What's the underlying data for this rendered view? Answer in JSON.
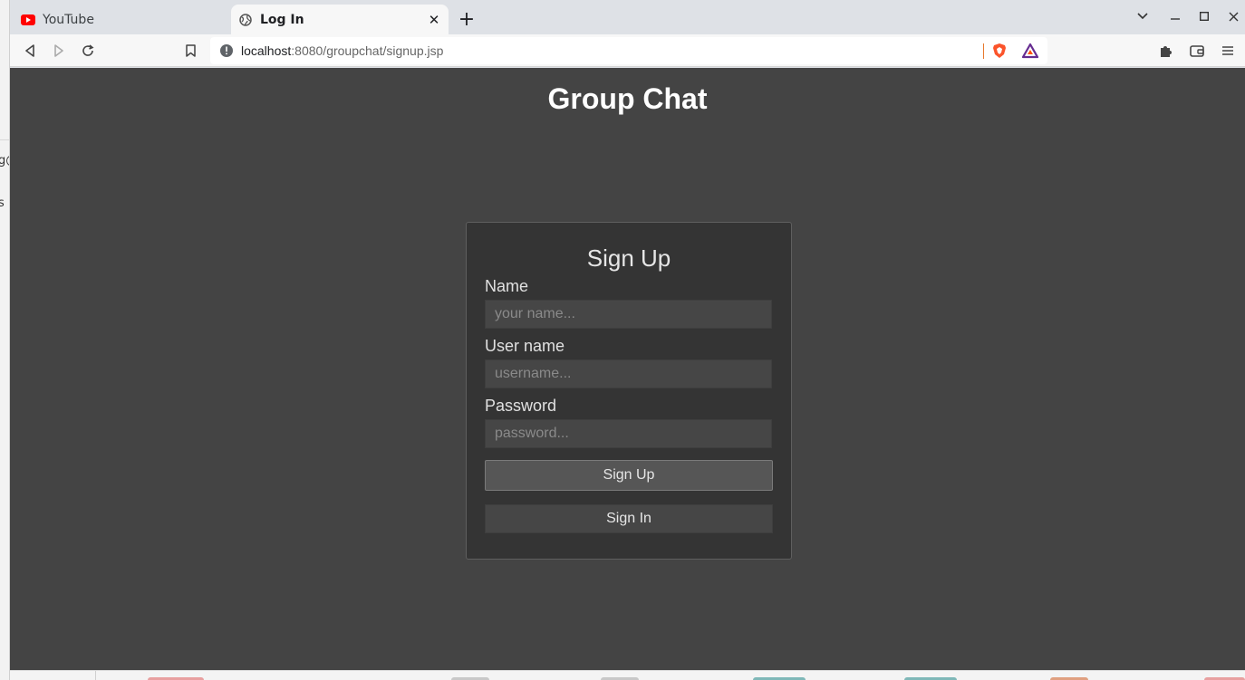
{
  "background": {
    "left_fragments": [
      "g@",
      "s"
    ]
  },
  "browser": {
    "tabs": [
      {
        "title": "YouTube",
        "icon": "youtube-icon",
        "active": false
      },
      {
        "title": "Log In",
        "icon": "globe-icon",
        "active": true
      }
    ],
    "address_bar": {
      "host": "localhost",
      "path": ":8080/groupchat/signup.jsp"
    }
  },
  "page": {
    "app_title": "Group Chat",
    "form": {
      "title": "Sign Up",
      "name_label": "Name",
      "name_placeholder": "your name...",
      "username_label": "User name",
      "username_placeholder": "username...",
      "password_label": "Password",
      "password_placeholder": "password...",
      "signup_button": "Sign Up",
      "signin_button": "Sign In"
    }
  },
  "colors": {
    "page_background": "#444444",
    "card_background": "#343434",
    "input_background": "#464646",
    "brave_orange": "#e8782b"
  }
}
